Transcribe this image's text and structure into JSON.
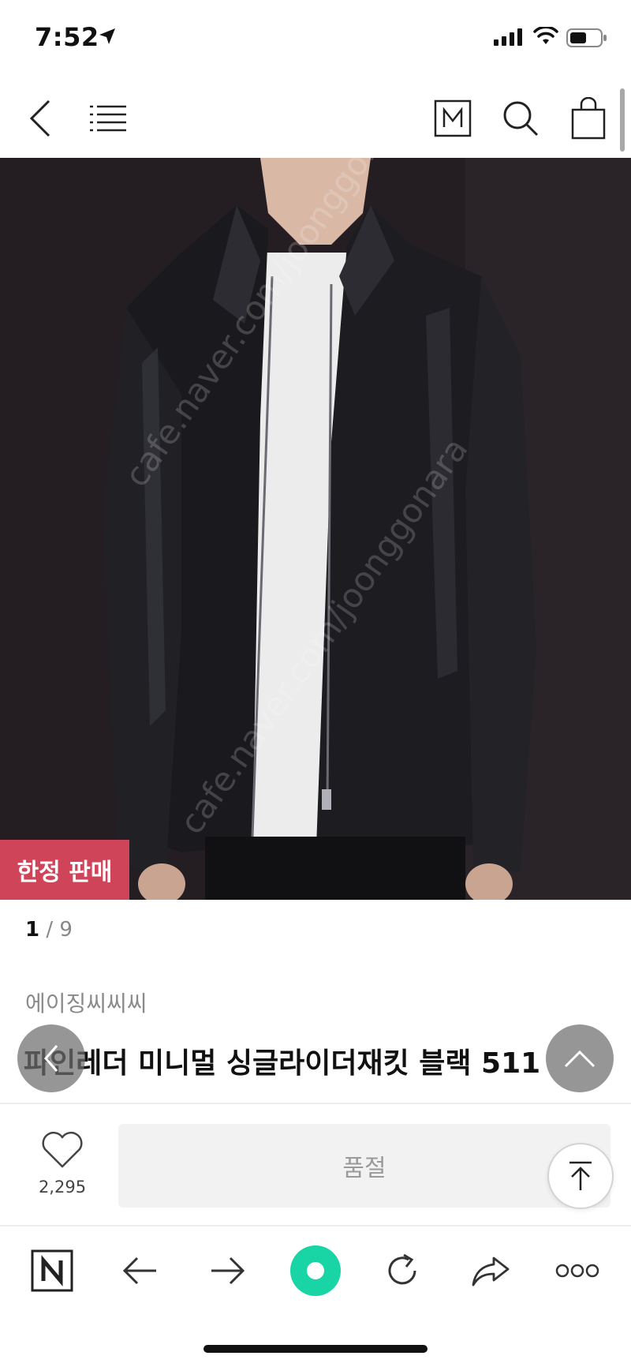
{
  "status_bar": {
    "time": "7:52"
  },
  "header": {
    "icons": [
      "back-icon",
      "menu-icon",
      "m-icon",
      "search-icon",
      "shopping-bag-icon"
    ]
  },
  "product": {
    "image_watermark": "cafe.naver.com/joonggonara",
    "badge": "한정 판매",
    "page_current": "1",
    "page_separator": " / ",
    "page_total": "9",
    "brand": "에이징씨씨씨",
    "title": "파인레더 미니멀 싱글라이더재킷 블랙 511"
  },
  "purchase": {
    "like_count": "2,295",
    "status_label": "품절"
  },
  "toolbar": {
    "icons": [
      "naver-n-icon",
      "arrow-left-icon",
      "arrow-right-icon",
      "green-dot-icon",
      "reload-icon",
      "share-icon",
      "more-icon"
    ]
  },
  "colors": {
    "badge_bg": "#d0445a",
    "green_accent": "#19d5a5",
    "image_bg": "#241e22"
  }
}
